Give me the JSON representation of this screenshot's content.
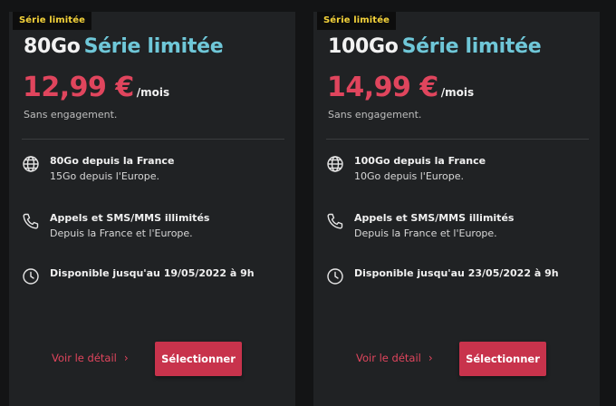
{
  "accent_colors": {
    "price": "#e0455d",
    "title_highlight": "#6fc7d8",
    "badge_text": "#f5d33a",
    "button": "#c8334c"
  },
  "offers": [
    {
      "badge": "Série limitée",
      "data_amount": "80Go",
      "title_suffix": "Série limitée",
      "price": "12,99 €",
      "period": "/mois",
      "commitment": "Sans engagement.",
      "features": [
        {
          "icon": "globe-icon",
          "line1": "80Go depuis la France",
          "line2": "15Go depuis l'Europe."
        },
        {
          "icon": "phone-icon",
          "line1": "Appels et SMS/MMS illimités",
          "line2": "Depuis la France et l'Europe."
        },
        {
          "icon": "clock-icon",
          "line1": "Disponible jusqu'au 19/05/2022 à 9h",
          "line2": ""
        }
      ],
      "detail_link": "Voir le détail",
      "select_button": "Sélectionner"
    },
    {
      "badge": "Série limitée",
      "data_amount": "100Go",
      "title_suffix": "Série limitée",
      "price": "14,99 €",
      "period": "/mois",
      "commitment": "Sans engagement.",
      "features": [
        {
          "icon": "globe-icon",
          "line1": "100Go depuis la France",
          "line2": "10Go depuis l'Europe."
        },
        {
          "icon": "phone-icon",
          "line1": "Appels et SMS/MMS illimités",
          "line2": "Depuis la France et l'Europe."
        },
        {
          "icon": "clock-icon",
          "line1": "Disponible jusqu'au 23/05/2022 à 9h",
          "line2": ""
        }
      ],
      "detail_link": "Voir le détail",
      "select_button": "Sélectionner"
    }
  ]
}
